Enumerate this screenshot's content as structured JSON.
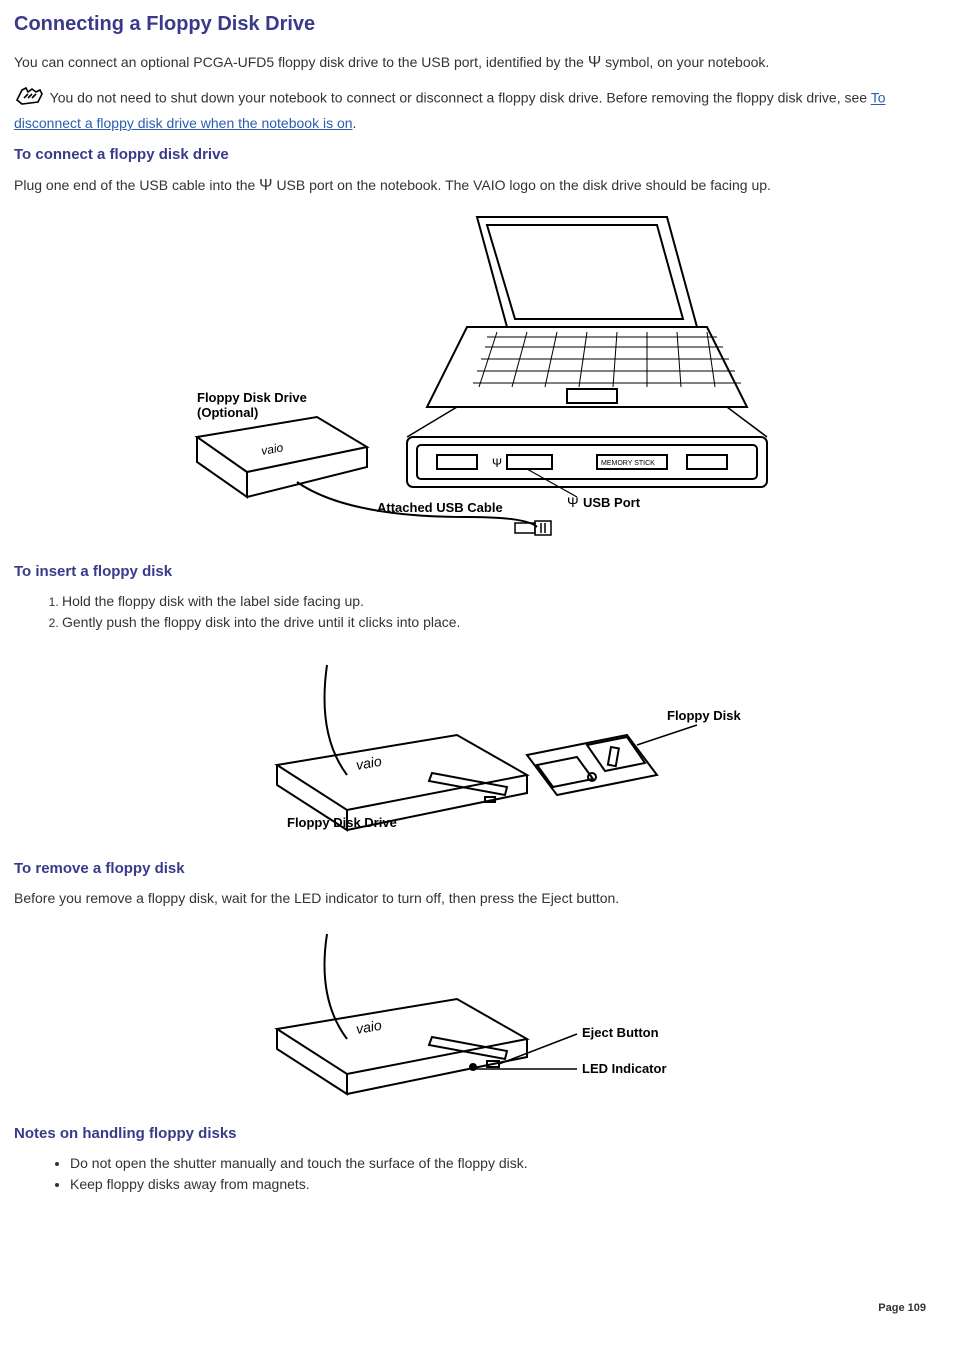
{
  "title": "Connecting a Floppy Disk Drive",
  "intro_before": "You can connect an optional PCGA-UFD5 floppy disk drive to the USB port, identified by the ",
  "intro_after": "symbol, on your notebook.",
  "note_before": "You do not need to shut down your notebook to connect or disconnect a floppy disk drive. Before removing the floppy disk drive, see ",
  "note_link": "To disconnect a floppy disk drive when the notebook is on",
  "note_after": ".",
  "section_connect": {
    "heading": "To connect a floppy disk drive",
    "para_before": "Plug one end of the USB cable into the ",
    "para_after": "USB port on the notebook. The VAIO logo on the disk drive should be facing up."
  },
  "fig1": {
    "label_drive_l1": "Floppy Disk Drive",
    "label_drive_l2": "(Optional)",
    "label_cable": "Attached USB Cable",
    "label_port": "USB Port",
    "label_ms": "MEMORY STICK"
  },
  "section_insert": {
    "heading": "To insert a floppy disk",
    "steps": [
      "Hold the floppy disk with the label side facing up.",
      "Gently push the floppy disk into the drive until it clicks into place."
    ]
  },
  "fig2": {
    "label_drive": "Floppy Disk Drive",
    "label_disk": "Floppy Disk"
  },
  "section_remove": {
    "heading": "To remove a floppy disk",
    "para": "Before you remove a floppy disk, wait for the LED indicator to turn off, then press the Eject button."
  },
  "fig3": {
    "label_eject": "Eject Button",
    "label_led": "LED Indicator"
  },
  "section_notes": {
    "heading": "Notes on handling floppy disks",
    "items": [
      "Do not open the shutter manually and touch the surface of the floppy disk.",
      "Keep floppy disks away from magnets."
    ]
  },
  "page_label": "Page 109"
}
